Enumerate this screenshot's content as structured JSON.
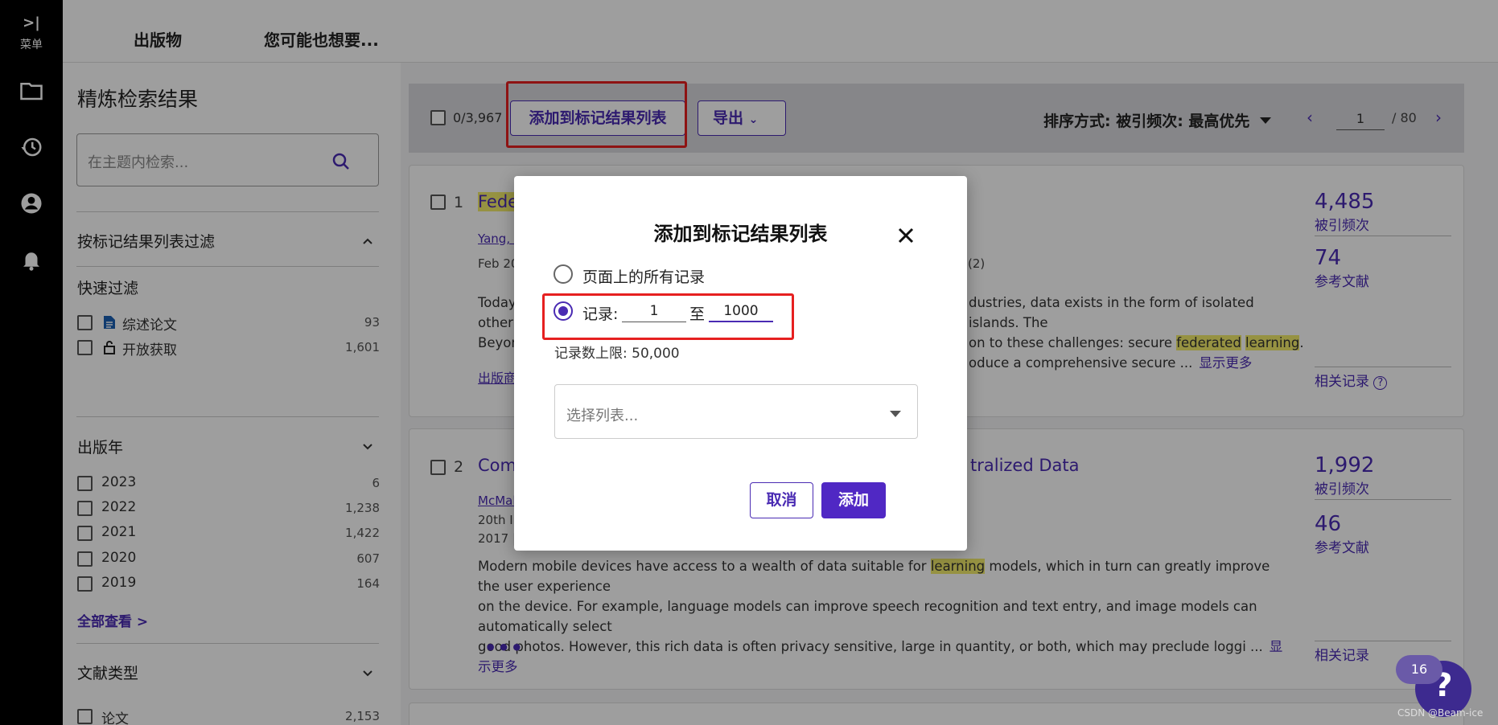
{
  "rail": {
    "menu_label": "菜单"
  },
  "topnav": {
    "tab_publications": "出版物",
    "tab_suggest": "您可能也想要..."
  },
  "sidebar": {
    "title": "精炼检索结果",
    "search_placeholder": "在主题内检索...",
    "section_marked": "按标记结果列表过滤",
    "section_quick": "快速过滤",
    "quick_filters": [
      {
        "label": "综述论文",
        "count": "93",
        "icon": "document-icon"
      },
      {
        "label": "开放获取",
        "count": "1,601",
        "icon": "lock-icon"
      }
    ],
    "section_year": "出版年",
    "years": [
      {
        "label": "2023",
        "count": "6"
      },
      {
        "label": "2022",
        "count": "1,238"
      },
      {
        "label": "2021",
        "count": "1,422"
      },
      {
        "label": "2020",
        "count": "607"
      },
      {
        "label": "2019",
        "count": "164"
      }
    ],
    "see_all": "全部查看 >",
    "section_doctype": "文献类型",
    "doctypes": [
      {
        "label": "论文",
        "count": "2,153"
      }
    ]
  },
  "toolbar": {
    "selected_count": "0/3,967",
    "mark_button": "添加到标记结果列表",
    "export_button": "导出",
    "sort_label": "排序方式: 被引频次: 最高优先",
    "page_current": "1",
    "page_total": "/ 80"
  },
  "results": [
    {
      "index": "1",
      "title_visible": "Fede",
      "author_visible": "Yang, C",
      "meta_visible": "Feb 20",
      "meta_right": "(2)",
      "abstract_left": [
        "Today",
        "other i",
        "Beyon"
      ],
      "abstract_right_1": "dustries, data exists in the form of isolated islands. The",
      "abstract_right_2a": "on to these challenges: secure ",
      "abstract_right_2b": "federated",
      "abstract_right_2c": "learning",
      "abstract_right_3": "oduce a comprehensive secure ...",
      "show_more": "显示更多",
      "publisher_link": "出版商",
      "citations": "4,485",
      "citations_label": "被引频次",
      "references": "74",
      "references_label": "参考文献",
      "related": "相关记录"
    },
    {
      "index": "2",
      "title_left": "Com",
      "title_right": "tralized Data",
      "author_visible": "McMal",
      "meta_line1": "20th In",
      "meta_line2": "2017 |",
      "abstract_1a": "Modern mobile devices have access to a wealth of data suitable for ",
      "abstract_1b": "learning",
      "abstract_1c": " models, which in turn can greatly improve the user experience",
      "abstract_2": "on the device. For example, language models can improve speech recognition and text entry, and image models can automatically select",
      "abstract_3": "good photos. However, this rich data is often privacy sensitive, large in quantity, or both, which may preclude loggi ...",
      "show_more": "显示更多",
      "dots": "•••",
      "citations": "1,992",
      "citations_label": "被引频次",
      "references": "46",
      "references_label": "参考文献",
      "related": "相关记录"
    }
  ],
  "modal": {
    "title": "添加到标记结果列表",
    "option_all": "页面上的所有记录",
    "option_records": "记录:",
    "from_value": "1",
    "to_label": "至",
    "to_value": "1000",
    "limit_text": "记录数上限: 50,000",
    "select_placeholder": "选择列表...",
    "cancel": "取消",
    "add": "添加"
  },
  "help": {
    "badge": "16",
    "glyph": "?"
  },
  "watermark": "CSDN @Beam-ice",
  "colors": {
    "accent": "#4a2bb3",
    "highlight_box": "#e62020",
    "keyword_mark": "#f2ec6b"
  }
}
